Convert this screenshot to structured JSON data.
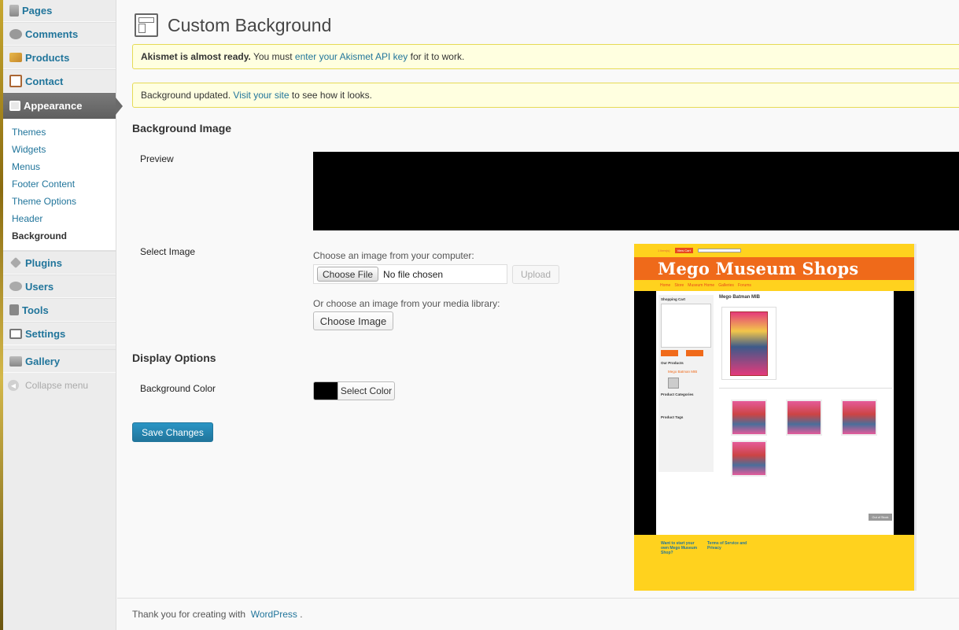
{
  "sidebar": {
    "items_top": [
      {
        "label": "Pages",
        "icon": "pages-icon"
      },
      {
        "label": "Comments",
        "icon": "comments-icon"
      },
      {
        "label": "Products",
        "icon": "products-icon"
      },
      {
        "label": "Contact",
        "icon": "contact-icon"
      }
    ],
    "appearance_label": "Appearance",
    "submenu": [
      "Themes",
      "Widgets",
      "Menus",
      "Footer Content",
      "Theme Options",
      "Header",
      "Background"
    ],
    "items_bottom": [
      {
        "label": "Plugins",
        "icon": "plugins-icon"
      },
      {
        "label": "Users",
        "icon": "users-icon"
      },
      {
        "label": "Tools",
        "icon": "tools-icon"
      },
      {
        "label": "Settings",
        "icon": "settings-icon"
      }
    ],
    "gallery_label": "Gallery",
    "collapse_label": "Collapse menu"
  },
  "page": {
    "title": "Custom Background"
  },
  "notices": {
    "akismet_bold": "Akismet is almost ready.",
    "akismet_pre": " You must ",
    "akismet_link": "enter your Akismet API key",
    "akismet_post": " for it to work.",
    "updated_pre": "Background updated. ",
    "updated_link": "Visit your site",
    "updated_post": " to see how it looks."
  },
  "background_image": {
    "heading": "Background Image",
    "preview_label": "Preview",
    "select_label": "Select Image",
    "computer_hint": "Choose an image from your computer:",
    "choose_file": "Choose File",
    "no_file": "No file chosen",
    "upload": "Upload",
    "library_hint": "Or choose an image from your media library:",
    "choose_image": "Choose Image"
  },
  "display_options": {
    "heading": "Display Options",
    "bg_color_label": "Background Color",
    "select_color": "Select Color",
    "swatch_color": "#000000"
  },
  "save_label": "Save Changes",
  "footer": {
    "pre": "Thank you for creating with ",
    "link": "WordPress",
    "post": "."
  },
  "thumbnail": {
    "site_title": "Mego Museum Shops",
    "cart_heading": "Shopping Cart",
    "our_products": "Our Products",
    "product_link": "Mego Batman MIB",
    "categories": "Product Categories",
    "tags": "Product Tags",
    "product_title": "Mego Batman MIB",
    "view_cart": "View Cart",
    "out_of_stock": "Out of Stock",
    "footer_col1": "Want to start your own Mego Museum Shop?",
    "footer_col2": "Terms of Service and Privacy"
  }
}
